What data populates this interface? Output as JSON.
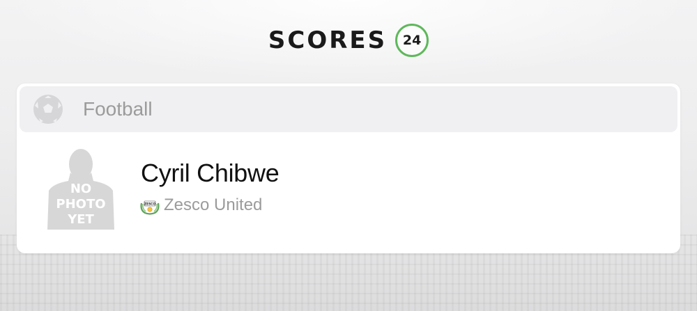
{
  "brand": {
    "name": "SCORES",
    "badge": "24",
    "accent_color": "#5fb85b"
  },
  "card": {
    "sport": {
      "label": "Football",
      "icon": "soccer-ball-icon"
    },
    "player": {
      "name": "Cyril Chibwe",
      "photo_placeholder": [
        "NO",
        "PHOTO",
        "YET"
      ],
      "team": {
        "name": "Zesco United",
        "logo": "zesco-united-crest",
        "logo_text": "ZESCO"
      }
    }
  }
}
